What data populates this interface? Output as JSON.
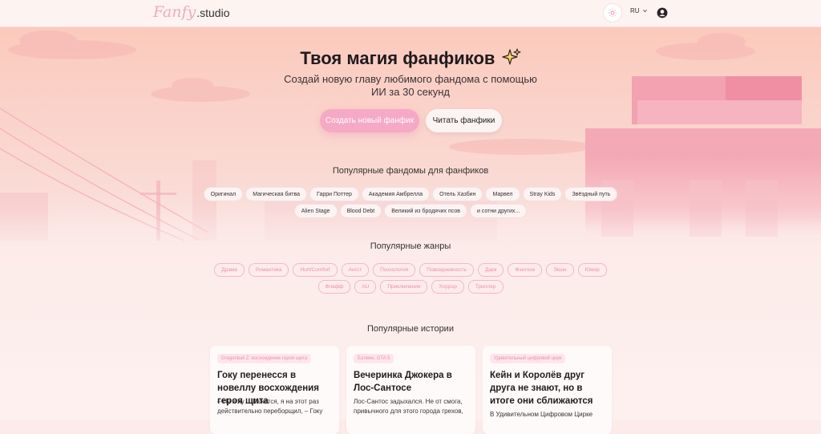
{
  "header": {
    "logo_script": "Fanfy",
    "logo_suffix": ".studio",
    "language": "RU",
    "icons": [
      "sun-icon",
      "chevron-down-icon",
      "user-circle-icon"
    ]
  },
  "hero": {
    "title": "Твоя магия фанфиков",
    "subtitle": "Создай новую главу любимого фандома с помощью ИИ за 30 секунд",
    "primary_button": "Создать новый фанфик",
    "secondary_button": "Читать фанфики"
  },
  "fandoms": {
    "title": "Популярные фандомы для фанфиков",
    "row1": [
      "Оригинал",
      "Магическая битва",
      "Гарри Поттер",
      "Академия Амбрелла",
      "Отель Хазбин",
      "Марвел",
      "Stray Kids",
      "Звёздный путь"
    ],
    "row2": [
      "Alien Stage",
      "Blood Debt",
      "Великий из бродячих псов",
      "и сотни других..."
    ]
  },
  "genres": {
    "title": "Популярные жанры",
    "row1": [
      "Драма",
      "Романтика",
      "Hurt/Comfort",
      "Ангст",
      "Психология",
      "Повседневность",
      "Дарк",
      "Фэнтези",
      "Экшн",
      "Юмор"
    ],
    "row2": [
      "Флафф",
      "AU",
      "Приключения",
      "Хоррор",
      "Триллер"
    ]
  },
  "stories": {
    "title": "Популярные истории",
    "cards": [
      {
        "tag": "Dragonball Z: восхождение героя щита",
        "title": "Гоку перенесся в новеллу восхождения героя щита",
        "excerpt": "– Ну и ну… Кажется, я на этот раз действительно переборщил, – Гоку"
      },
      {
        "tag": "Бэтмен, GTA 5",
        "title": "Вечеринка Джокера в Лос-Сантосе",
        "excerpt": "Лос-Сантос задыхался. Не от смога, привычного для этого города грехов,"
      },
      {
        "tag": "Удивительный цифровой цирк",
        "title": "Кейн и Королёв друг друга не знают, но в итоге они сближаются",
        "excerpt": "В Удивительном Цифровом Цирке"
      }
    ]
  },
  "colors": {
    "accent": "#f6a9c5",
    "background": "#fcebe9",
    "genre_text": "#f08eb0"
  }
}
